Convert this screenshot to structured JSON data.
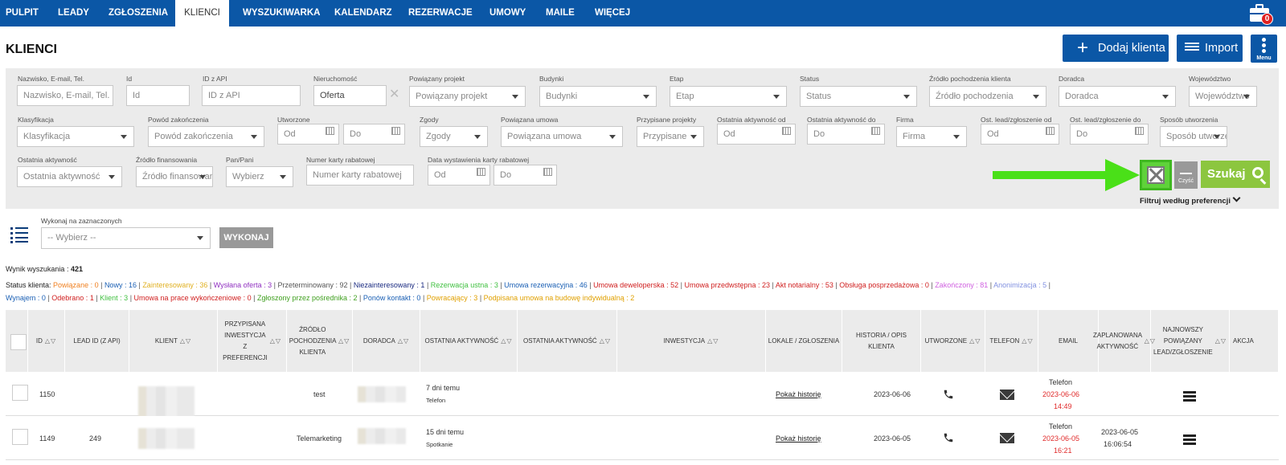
{
  "nav": {
    "items": [
      "PULPIT",
      "LEADY",
      "ZGŁOSZENIA",
      "KLIENCI",
      "WYSZUKIWARKA",
      "KALENDARZ",
      "REZERWACJE",
      "UMOWY",
      "MAILE",
      "WIĘCEJ"
    ],
    "active": "KLIENCI",
    "notif_count": "0"
  },
  "header": {
    "title": "KLIENCI",
    "add_label": "Dodaj klienta",
    "import_label": "Import",
    "menu_label": "Menu"
  },
  "filters": {
    "row1": [
      {
        "label": "Nazwisko, E-mail, Tel.",
        "placeholder": "Nazwisko, E-mail, Tel."
      },
      {
        "label": "Id",
        "placeholder": "Id"
      },
      {
        "label": "ID z API",
        "placeholder": "ID z API"
      },
      {
        "label": "Nieruchomość",
        "value": "Oferta"
      },
      {
        "label": "Powiązany projekt",
        "placeholder": "Powiązany projekt"
      },
      {
        "label": "Budynki",
        "placeholder": "Budynki"
      },
      {
        "label": "Etap",
        "placeholder": "Etap"
      },
      {
        "label": "Status",
        "placeholder": "Status"
      },
      {
        "label": "Źródło pochodzenia klienta",
        "placeholder": "Źródło pochodzenia"
      },
      {
        "label": "Doradca",
        "placeholder": "Doradca"
      },
      {
        "label": "Województwo",
        "placeholder": "Województwo"
      }
    ],
    "row2": [
      {
        "label": "Klasyfikacja",
        "placeholder": "Klasyfikacja"
      },
      {
        "label": "Powód zakończenia",
        "placeholder": "Powód zakończenia"
      },
      {
        "label": "Utworzone",
        "placeholder": "Od"
      },
      {
        "label": "",
        "placeholder": "Do"
      },
      {
        "label": "Zgody",
        "placeholder": "Zgody"
      },
      {
        "label": "Powiązana umowa",
        "placeholder": "Powiązana umowa"
      },
      {
        "label": "Przypisane projekty",
        "placeholder": "Przypisane"
      },
      {
        "label": "Ostatnia aktywność od",
        "placeholder": "Od"
      },
      {
        "label": "Ostatnia aktywność do",
        "placeholder": "Do"
      },
      {
        "label": "Firma",
        "placeholder": "Firma"
      },
      {
        "label": "Ost. lead/zgłoszenie od",
        "placeholder": "Od"
      },
      {
        "label": "Ost. lead/zgłoszenie do",
        "placeholder": "Do"
      },
      {
        "label": "Sposób utworzenia",
        "placeholder": "Sposób utworzenia"
      }
    ],
    "row3": [
      {
        "label": "Ostatnia aktywność",
        "placeholder": "Ostatnia aktywność"
      },
      {
        "label": "Źródło finansowania",
        "placeholder": "Źródło finansowania"
      },
      {
        "label": "Pan/Pani",
        "placeholder": "Wybierz"
      },
      {
        "label": "Numer karty rabatowej",
        "placeholder": "Numer karty rabatowej"
      },
      {
        "label": "Data wystawienia karty rabatowej",
        "placeholder": "Od"
      },
      {
        "label": "",
        "placeholder": "Do"
      }
    ],
    "clear_label": "Czyść",
    "search_label": "Szukaj",
    "pref_label": "Filtruj według preferencji"
  },
  "bulk": {
    "label": "Wykonaj na zaznaczonych",
    "placeholder": "-- Wybierz --",
    "button": "WYKONAJ"
  },
  "result": {
    "label": "Wynik wyszukania :",
    "count": "421"
  },
  "status_colors": {
    "orange": "#f08020",
    "blue": "#1a5fb4",
    "yellow": "#e0b020",
    "purple": "#9030c0",
    "gray": "#555555",
    "navy": "#1a2a80",
    "green": "#40c040",
    "red": "#d02020",
    "pink": "#d060e0",
    "lilac": "#8090e0",
    "olive": "#40a020",
    "gold": "#e0a000"
  },
  "status": {
    "prefix": "Status klienta:",
    "line1": [
      {
        "t": "Powiązane : 0",
        "c": "orange"
      },
      {
        "t": "Nowy : 16",
        "c": "blue"
      },
      {
        "t": "Zainteresowany : 36",
        "c": "yellow"
      },
      {
        "t": "Wysłana oferta : 3",
        "c": "purple"
      },
      {
        "t": "Przeterminowany : 92",
        "c": "gray"
      },
      {
        "t": "Niezainteresowany : 1",
        "c": "navy"
      },
      {
        "t": "Rezerwacja ustna : 3",
        "c": "green"
      },
      {
        "t": "Umowa rezerwacyjna : 46",
        "c": "blue"
      },
      {
        "t": "Umowa deweloperska : 52",
        "c": "red"
      },
      {
        "t": "Umowa przedwstępna : 23",
        "c": "red"
      },
      {
        "t": "Akt notarialny : 53",
        "c": "red"
      },
      {
        "t": "Obsługa posprzedażowa : 0",
        "c": "red"
      },
      {
        "t": "Zakończony : 81",
        "c": "pink"
      },
      {
        "t": "Anonimizacja : 5",
        "c": "lilac"
      }
    ],
    "line2": [
      {
        "t": "Wynajem : 0",
        "c": "blue"
      },
      {
        "t": "Odebrano : 1",
        "c": "red"
      },
      {
        "t": "Klient : 3",
        "c": "green"
      },
      {
        "t": "Umowa na prace wykończeniowe : 0",
        "c": "red"
      },
      {
        "t": "Zgłoszony przez pośrednika : 2",
        "c": "olive"
      },
      {
        "t": "Ponów kontakt : 0",
        "c": "blue"
      },
      {
        "t": "Powracający : 3",
        "c": "gold"
      },
      {
        "t": "Podpisana umowa na budowę indywidualną : 2",
        "c": "gold"
      }
    ]
  },
  "table": {
    "headers": {
      "id": "ID",
      "lead": "LEAD ID (Z API)",
      "client": "KLIENT",
      "assigned": "PRZYPISANA INWESTYCJA Z PREFERENCJI",
      "source": "ŹRÓDŁO POCHODZENIA KLIENTA",
      "advisor": "DORADCA",
      "last1": "OSTATNIA AKTYWNOŚĆ",
      "last2": "OSTATNIA AKTYWNOŚĆ",
      "invest": "INWESTYCJA",
      "lokale": "LOKALE / ZGŁOSZENIA",
      "history": "HISTORIA / OPIS KLIENTA",
      "created": "UTWORZONE",
      "phone": "TELEFON",
      "email": "EMAIL",
      "planned": "ZAPLANOWANA AKTYWNOŚĆ",
      "newest": "NAJNOWSZY POWIĄZANY LEAD/ZGŁOSZENIE",
      "action": "AKCJA"
    },
    "rows": [
      {
        "id": "1150",
        "lead": "",
        "source": "test",
        "last_time": "7 dni temu",
        "last_type": "Telefon",
        "history_link": "Pokaż historię",
        "created": "2023-06-06",
        "planned_type": "Telefon",
        "planned_date": "2023-06-06",
        "planned_time": "14:49",
        "newest_date": "",
        "newest_time": ""
      },
      {
        "id": "1149",
        "lead": "249",
        "source": "Telemarketing",
        "last_time": "15 dni temu",
        "last_type": "Spotkanie",
        "history_link": "Pokaż historię",
        "created": "2023-06-05",
        "planned_type": "Telefon",
        "planned_date": "2023-06-05",
        "planned_time": "16:21",
        "newest_date": "2023-06-05",
        "newest_time": "16:06:54"
      }
    ]
  }
}
